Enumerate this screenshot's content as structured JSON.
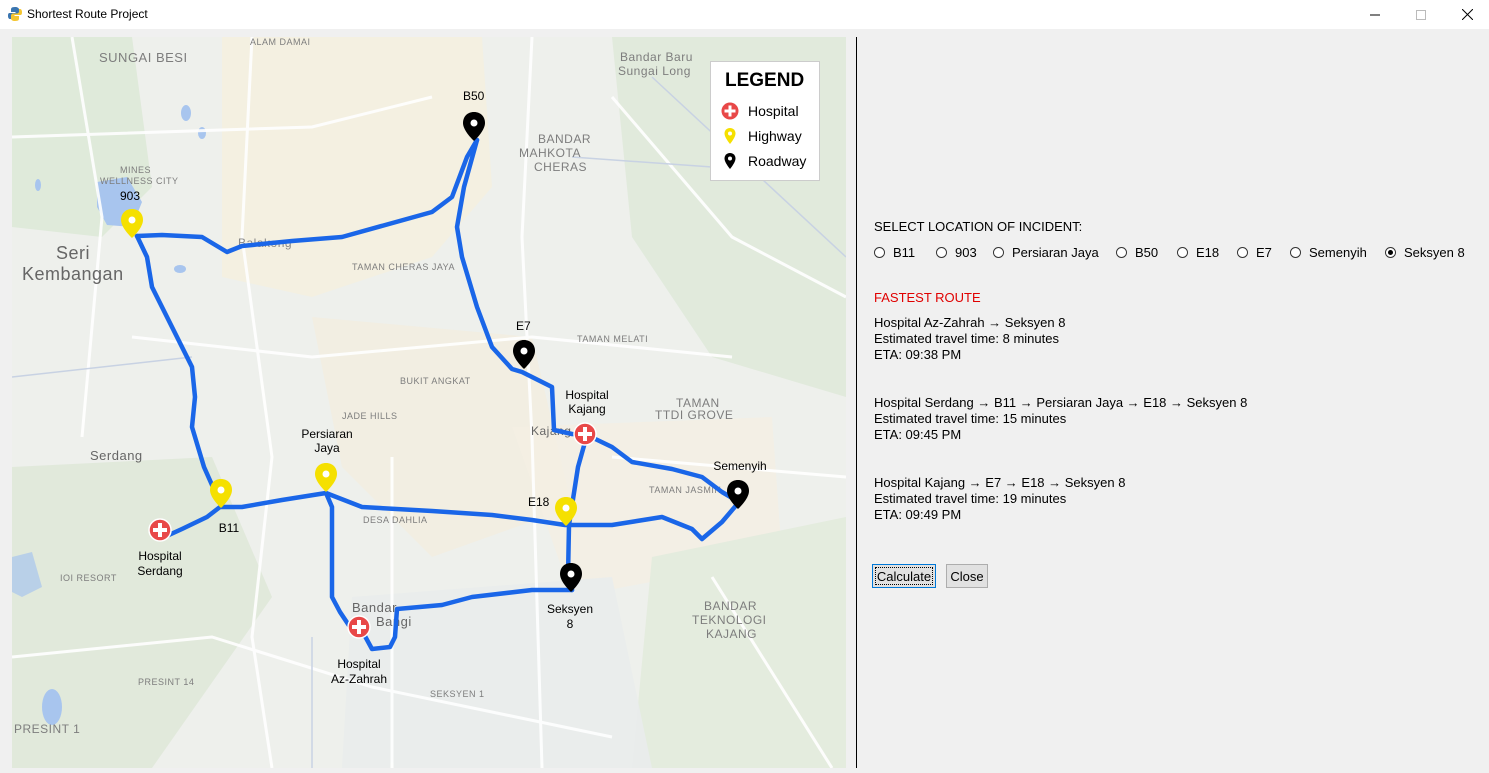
{
  "window": {
    "title": "Shortest Route Project",
    "minimize": "—",
    "maximize": "☐",
    "close": "✕"
  },
  "legend": {
    "title": "LEGEND",
    "items": [
      {
        "label": "Hospital",
        "icon": "hospital-icon",
        "color": "#e84848"
      },
      {
        "label": "Highway",
        "icon": "highway-pin-icon",
        "color": "#f5e000"
      },
      {
        "label": "Roadway",
        "icon": "roadway-pin-icon",
        "color": "#000000"
      }
    ]
  },
  "map": {
    "route_color": "#1a66e8",
    "background_labels": [
      "SUNGAI BESI",
      "ALAM DAMAI",
      "Bandar Baru",
      "Sungai Long",
      "BANDAR",
      "MAHKOTA",
      "CHERAS",
      "Seri",
      "Kembangan",
      "Balakong",
      "TAMAN CHERAS JAYA",
      "BUKIT ANGKAT",
      "JADE HILLS",
      "Serdang",
      "Kajang",
      "TAMAN",
      "TTDI GROVE",
      "DESA DAHLIA",
      "Bandar",
      "Bangi",
      "BANDAR",
      "TEKNOLOGI",
      "KAJANG",
      "PRESINT 1",
      "SEKSYEN 1",
      "IOI RESORT",
      "PRESINT 14",
      "TAMAN MELATI",
      "MINES",
      "WELLNESS CITY",
      "TAMAN JASMIN"
    ],
    "nodes": {
      "b50": "B50",
      "n903": "903",
      "e7": "E7",
      "hospital_kajang": [
        "Hospital",
        "Kajang"
      ],
      "persiaran_jaya": [
        "Persiaran",
        "Jaya"
      ],
      "semenyih": "Semenyih",
      "e18": "E18",
      "b11": "B11",
      "hospital_serdang": [
        "Hospital",
        "Serdang"
      ],
      "seksyen8": [
        "Seksyen",
        "8"
      ],
      "hospital_az_zahrah": [
        "Hospital",
        "Az-Zahrah"
      ]
    }
  },
  "panel": {
    "select_label": "SELECT LOCATION OF INCIDENT:",
    "options": [
      "B11",
      "903",
      "Persiaran Jaya",
      "B50",
      "E18",
      "E7",
      "Semenyih",
      "Seksyen 8"
    ],
    "selected": "Seksyen 8",
    "fastest_title": "FASTEST ROUTE",
    "routes": [
      {
        "path": "Hospital Az-Zahrah → Seksyen 8",
        "time": "Estimated travel time: 8 minutes",
        "eta": "ETA: 09:38 PM"
      },
      {
        "path": "Hospital Serdang → B11 → Persiaran Jaya → E18 → Seksyen 8",
        "time": "Estimated travel time: 15 minutes",
        "eta": "ETA: 09:45 PM"
      },
      {
        "path": "Hospital Kajang → E7 → E18 → Seksyen 8",
        "time": "Estimated travel time: 19 minutes",
        "eta": "ETA: 09:49 PM"
      }
    ],
    "calculate_label": "Calculate",
    "close_label": "Close"
  }
}
